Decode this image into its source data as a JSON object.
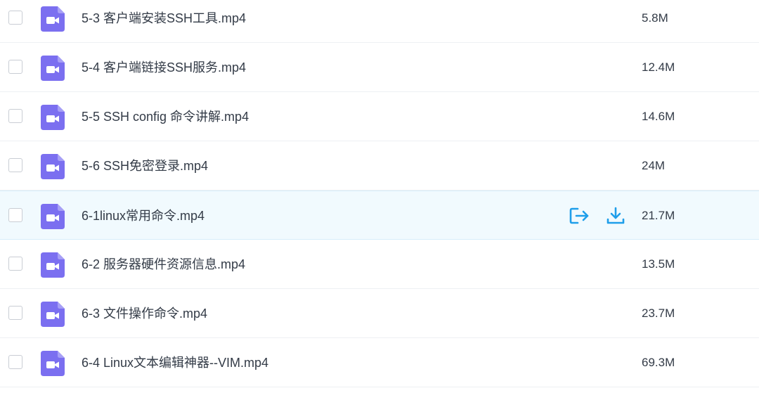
{
  "files": [
    {
      "name": "5-3 客户端安装SSH工具.mp4",
      "size": "5.8M",
      "icon": "video-file-icon"
    },
    {
      "name": "5-4 客户端链接SSH服务.mp4",
      "size": "12.4M",
      "icon": "video-file-icon"
    },
    {
      "name": "5-5 SSH config 命令讲解.mp4",
      "size": "14.6M",
      "icon": "video-file-icon"
    },
    {
      "name": "5-6 SSH免密登录.mp4",
      "size": "24M",
      "icon": "video-file-icon"
    },
    {
      "name": "6-1linux常用命令.mp4",
      "size": "21.7M",
      "icon": "video-file-icon",
      "hovered": true,
      "actions": [
        {
          "icon": "share-icon"
        },
        {
          "icon": "download-icon"
        }
      ]
    },
    {
      "name": "6-2 服务器硬件资源信息.mp4",
      "size": "13.5M",
      "icon": "video-file-icon"
    },
    {
      "name": "6-3 文件操作命令.mp4",
      "size": "23.7M",
      "icon": "video-file-icon"
    },
    {
      "name": "6-4 Linux文本编辑神器--VIM.mp4",
      "size": "69.3M",
      "icon": "video-file-icon"
    }
  ],
  "colors": {
    "icon_purple": "#7b6ff0",
    "action_blue": "#1e9eea",
    "hover_row": "#f1fafe"
  }
}
